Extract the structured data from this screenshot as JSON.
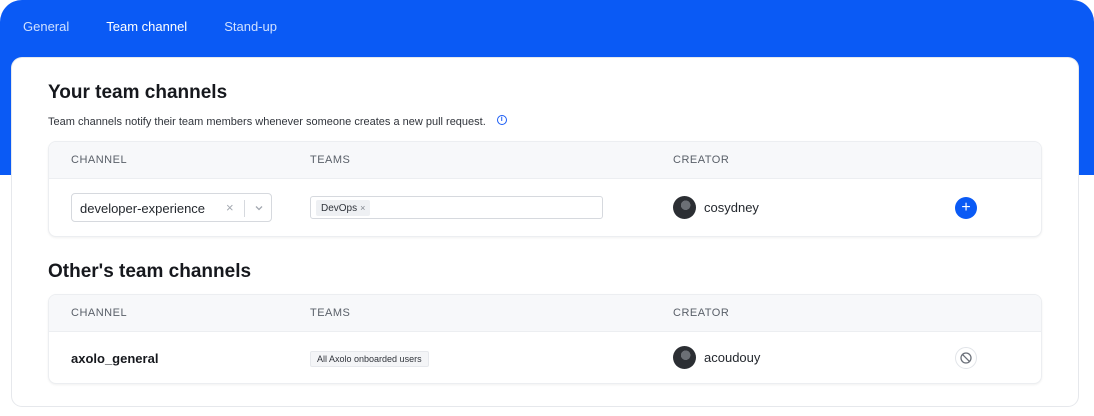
{
  "tabs": [
    {
      "label": "General"
    },
    {
      "label": "Team channel"
    },
    {
      "label": "Stand-up"
    }
  ],
  "your_section": {
    "title": "Your team channels",
    "description": "Team channels notify their team members whenever someone creates a new pull request.",
    "info_icon": "info-icon",
    "columns": {
      "channel": "CHANNEL",
      "teams": "TEAMS",
      "creator": "CREATOR"
    },
    "row": {
      "channel_select_value": "developer-experience",
      "clear_glyph": "×",
      "team_tag": "DevOps",
      "tag_remove_glyph": "×",
      "creator": "cosydney",
      "add_glyph": "+"
    }
  },
  "others_section": {
    "title": "Other's team channels",
    "columns": {
      "channel": "CHANNEL",
      "teams": "TEAMS",
      "creator": "CREATOR"
    },
    "row": {
      "channel": "axolo_general",
      "team_tag": "All Axolo onboarded users",
      "creator": "acoudouy",
      "action_icon": "ban-icon"
    }
  },
  "colors": {
    "accent": "#0a5af5",
    "tab_inactive": "#cfe0ff",
    "tab_active": "#ffffff"
  }
}
